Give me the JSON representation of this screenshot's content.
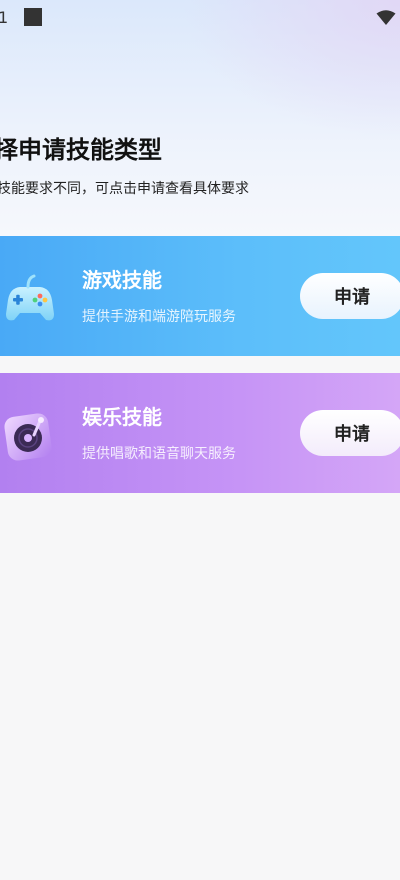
{
  "status_bar": {
    "time_fragment": "1",
    "wifi_icon": "wifi-icon"
  },
  "header": {
    "title": "择申请技能类型",
    "subtitle": "技能要求不同，可点击申请查看具体要求"
  },
  "cards": [
    {
      "title": "游戏技能",
      "description": "提供手游和端游陪玩服务",
      "button_label": "申请",
      "icon": "gamepad-icon",
      "color": "#4fb2f8"
    },
    {
      "title": "娱乐技能",
      "description": "提供唱歌和语音聊天服务",
      "button_label": "申请",
      "icon": "vinyl-record-icon",
      "color": "#bf8cf3"
    }
  ]
}
